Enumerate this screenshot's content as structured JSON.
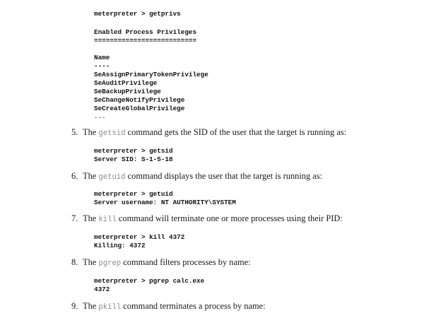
{
  "section_getprivs": {
    "prompt_line": "meterpreter > getprivs",
    "header": "Enabled Process Privileges",
    "rule": "==========================",
    "col_name": "Name",
    "col_rule": "----",
    "privileges": [
      "SeAssignPrimaryTokenPrivilege",
      "SeAuditPrivilege",
      "SeBackupPrivilege",
      "SeChangeNotifyPrivilege",
      "SeCreateGlobalPrivilege"
    ],
    "ellipsis": "..."
  },
  "items": [
    {
      "number": "5.",
      "pre": "The ",
      "code": "getsid",
      "post": " command gets the SID of the user that the target is running as:",
      "output": [
        "meterpreter > getsid",
        "Server SID: S-1-5-18"
      ]
    },
    {
      "number": "6.",
      "pre": "The ",
      "code": "getuid",
      "post": " command displays the user that the target is running as:",
      "output": [
        "meterpreter > getuid",
        "Server username: NT AUTHORITY\\SYSTEM"
      ]
    },
    {
      "number": "7.",
      "pre": "The ",
      "code": "kill",
      "post": " command will terminate one or more processes using their PID:",
      "output": [
        "meterpreter > kill 4372",
        "Killing: 4372"
      ]
    },
    {
      "number": "8.",
      "pre": "The ",
      "code": "pgrep",
      "post": " command filters processes by name:",
      "output": [
        "meterpreter > pgrep calc.exe",
        "4372"
      ]
    },
    {
      "number": "9.",
      "pre": "The ",
      "code": "pkill",
      "post": " command terminates a process by name:",
      "output": []
    }
  ]
}
